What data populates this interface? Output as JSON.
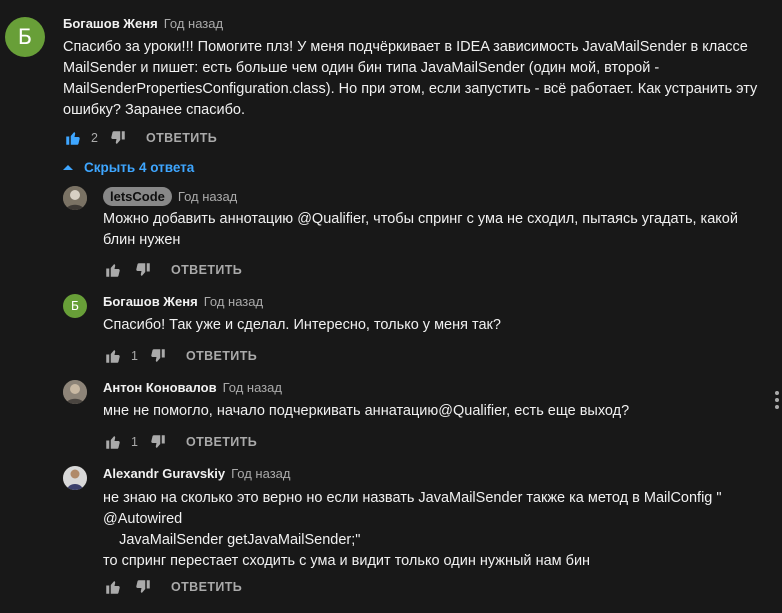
{
  "comment": {
    "avatar_letter": "Б",
    "author": "Богашов Женя",
    "time": "Год назад",
    "lines": [
      "Спасибо за уроки!!! Помогите плз! У меня подчёркивает в IDEA зависимость JavaMailSender в классе",
      "MailSender и пишет: есть больше чем один бин типа JavaMailSender (один мой, второй -",
      "MailSenderPropertiesConfiguration.class). Но при этом, если запустить - всё работает. Как устранить эту",
      "ошибку? Заранее спасибо."
    ],
    "likes": "2",
    "reply_label": "ОТВЕТИТЬ"
  },
  "toggle": {
    "label": "Скрыть 4 ответа",
    "icon": "chevron-up-icon"
  },
  "replies": [
    {
      "author": "letsCode",
      "time": "Год назад",
      "lines": [
        "Можно добавить аннотацию @Qualifier, чтобы спринг с ума не сходил, пытаясь угадать, какой",
        "блин нужен"
      ],
      "likes": "",
      "reply_label": "ОТВЕТИТЬ"
    },
    {
      "avatar_letter": "Б",
      "author": "Богашов Женя",
      "time": "Год назад",
      "lines": [
        "Спасибо! Так уже и сделал. Интересно, только у меня так?"
      ],
      "likes": "1",
      "reply_label": "ОТВЕТИТЬ"
    },
    {
      "author": "Антон Коновалов",
      "time": "Год назад",
      "lines": [
        "мне не помогло, начало подчеркивать аннатацию@Qualifier, есть еще выход?"
      ],
      "likes": "1",
      "reply_label": "ОТВЕТИТЬ"
    },
    {
      "author": "Alexandr Guravskiy",
      "time": "Год назад",
      "lines": [
        "не знаю на сколько это верно но если назвать JavaMailSender  также ка метод в MailConfig  \"",
        "@Autowired",
        "    JavaMailSender getJavaMailSender;\"",
        "то спринг перестает сходить с ума и видит только один нужный нам бин"
      ],
      "likes": "",
      "reply_label": "ОТВЕТИТЬ"
    }
  ],
  "colors": {
    "background": "#181818",
    "link": "#3ea6ff",
    "avatar_green": "#689f38",
    "liked": "#3ea6ff"
  }
}
